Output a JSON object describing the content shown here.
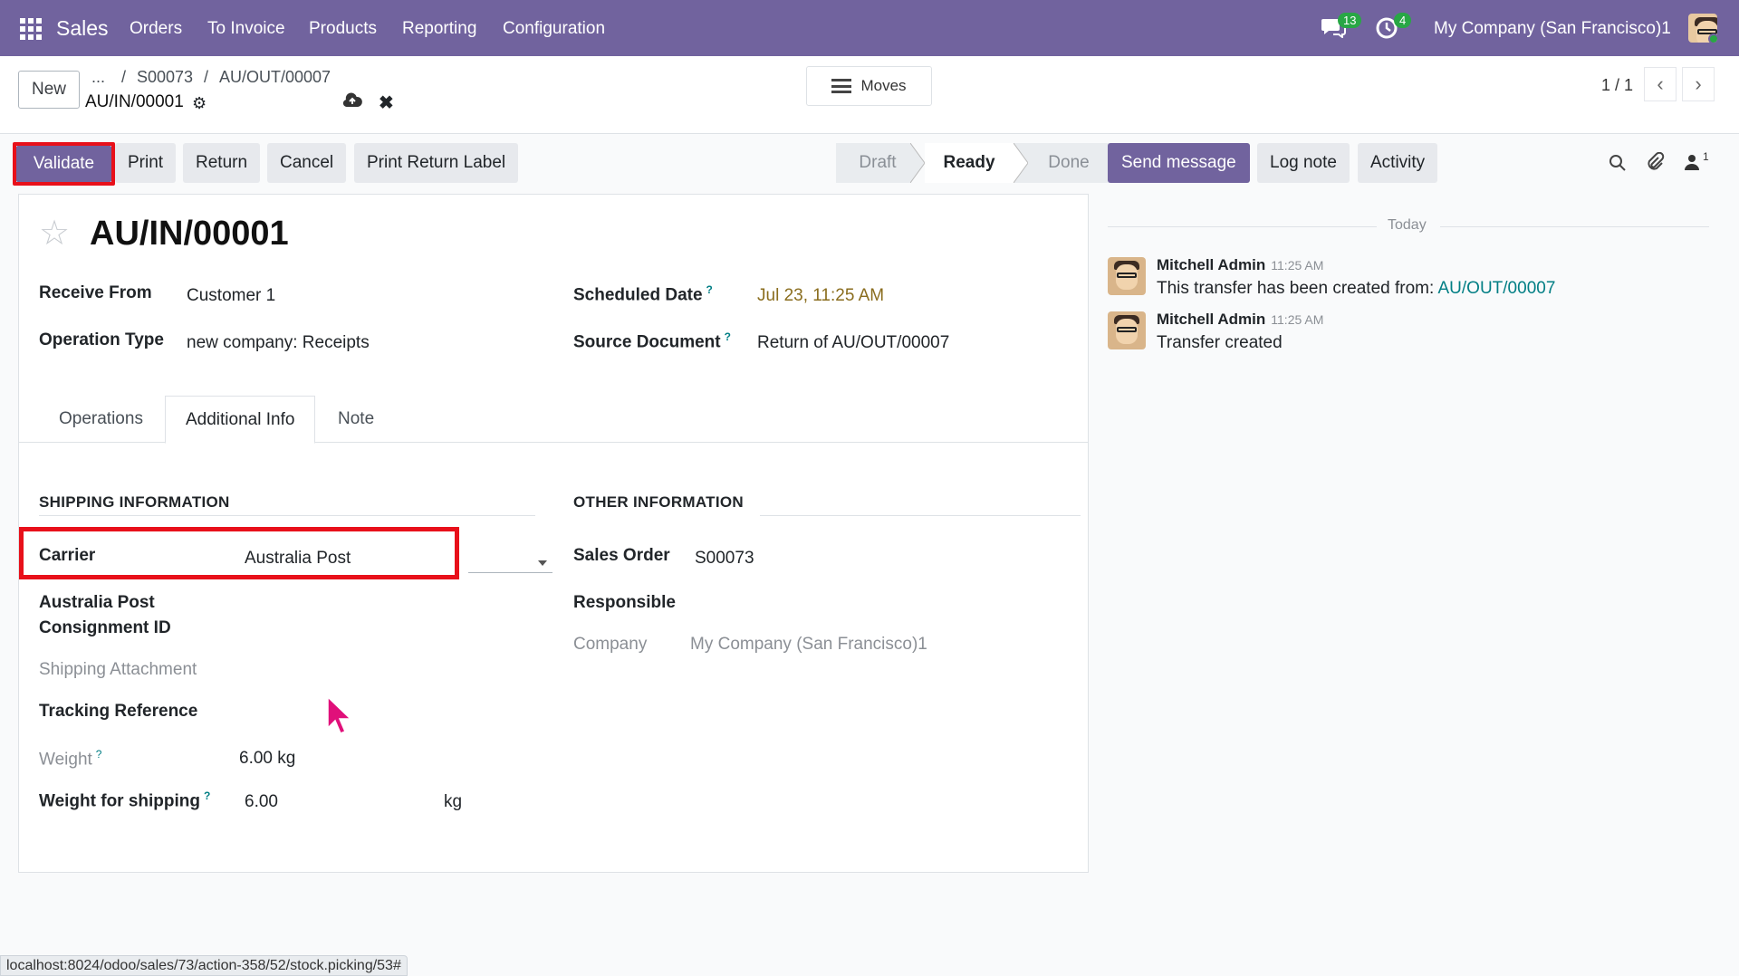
{
  "navbar": {
    "app_name": "Sales",
    "menu": [
      "Orders",
      "To Invoice",
      "Products",
      "Reporting",
      "Configuration"
    ],
    "messages_count": "13",
    "activities_count": "4",
    "company": "My Company (San Francisco)1",
    "apps_icon": "apps-grid-icon",
    "messages_icon": "chat-icon",
    "activities_icon": "clock-icon"
  },
  "control": {
    "new_label": "New",
    "breadcrumb_ellipsis": "...",
    "breadcrumb": [
      "S00073",
      "AU/OUT/00007"
    ],
    "record_name": "AU/IN/00001",
    "moves_label": "Moves",
    "pager": "1 / 1"
  },
  "actions": {
    "validate": "Validate",
    "print": "Print",
    "return": "Return",
    "cancel": "Cancel",
    "print_return_label": "Print Return Label"
  },
  "status": [
    "Draft",
    "Ready",
    "Done"
  ],
  "status_current": "Ready",
  "chatter": {
    "send_message": "Send message",
    "log_note": "Log note",
    "activity": "Activity",
    "followers_count": "1",
    "today": "Today",
    "messages": [
      {
        "author": "Mitchell Admin",
        "time": "11:25 AM",
        "text": "This transfer has been created from: ",
        "link": "AU/OUT/00007"
      },
      {
        "author": "Mitchell Admin",
        "time": "11:25 AM",
        "text": "Transfer created",
        "link": ""
      }
    ]
  },
  "form": {
    "title": "AU/IN/00001",
    "receive_from_label": "Receive From",
    "receive_from": "Customer 1",
    "operation_type_label": "Operation Type",
    "operation_type": "new company: Receipts",
    "scheduled_date_label": "Scheduled Date",
    "scheduled_date": "Jul 23, 11:25 AM",
    "source_document_label": "Source Document",
    "source_document": "Return of AU/OUT/00007",
    "tabs": [
      "Operations",
      "Additional Info",
      "Note"
    ],
    "active_tab": "Additional Info",
    "shipping_section": "SHIPPING INFORMATION",
    "other_section": "OTHER INFORMATION",
    "carrier_label": "Carrier",
    "carrier": "Australia Post",
    "consignment_label_1": "Australia Post",
    "consignment_label_2": "Consignment ID",
    "shipping_attachment_label": "Shipping Attachment",
    "tracking_reference_label": "Tracking Reference",
    "weight_label": "Weight",
    "weight": "6.00 kg",
    "weight_shipping_label": "Weight for shipping",
    "weight_shipping": "6.00",
    "weight_shipping_unit": "kg",
    "sales_order_label": "Sales Order",
    "sales_order": "S00073",
    "responsible_label": "Responsible",
    "company_label": "Company",
    "company": "My Company (San Francisco)1",
    "help_mark": "?"
  },
  "statusbar_url": "localhost:8024/odoo/sales/73/action-358/52/stock.picking/53#",
  "colors": {
    "brand": "#71639e",
    "highlight": "#e8101a",
    "date": "#8a6d1e",
    "link": "#017e84"
  }
}
